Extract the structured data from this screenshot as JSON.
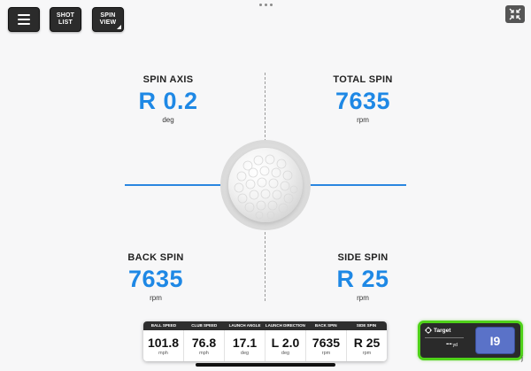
{
  "toolbar": {
    "shot_list_label": "SHOT\nLIST",
    "spin_view_label": "SPIN\nVIEW"
  },
  "spin": {
    "spin_axis": {
      "label": "SPIN AXIS",
      "value": "R 0.2",
      "unit": "deg"
    },
    "total_spin": {
      "label": "TOTAL SPIN",
      "value": "7635",
      "unit": "rpm"
    },
    "back_spin": {
      "label": "BACK SPIN",
      "value": "7635",
      "unit": "rpm"
    },
    "side_spin": {
      "label": "SIDE SPIN",
      "value": "R 25",
      "unit": "rpm"
    }
  },
  "stats": {
    "columns": [
      {
        "header": "BALL SPEED",
        "value": "101.8",
        "unit": "mph"
      },
      {
        "header": "CLUB SPEED",
        "value": "76.8",
        "unit": "mph"
      },
      {
        "header": "LAUNCH ANGLE",
        "value": "17.1",
        "unit": "deg"
      },
      {
        "header": "LAUNCH DIRECTION",
        "value": "L 2.0",
        "unit": "deg"
      },
      {
        "header": "BACK SPIN",
        "value": "7635",
        "unit": "rpm"
      },
      {
        "header": "SIDE SPIN",
        "value": "R 25",
        "unit": "rpm"
      }
    ]
  },
  "target": {
    "label": "Target",
    "value": "--",
    "unit": "yd",
    "club_label": "I9"
  },
  "colors": {
    "accent_blue": "#1e88e5",
    "axis_blue": "#2a86e0",
    "highlight_green": "#4fd11a",
    "club_button": "#5a72c8",
    "toolbar_dark": "#2b2b2b"
  }
}
